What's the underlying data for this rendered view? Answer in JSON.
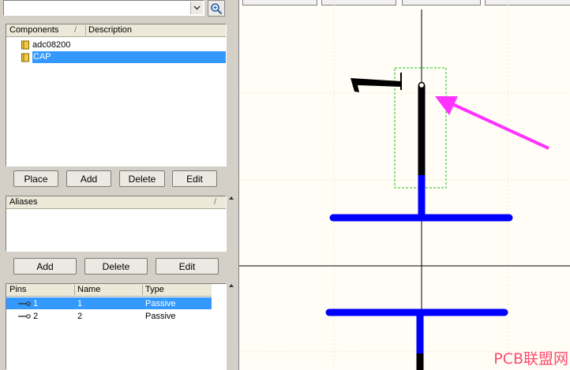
{
  "search": {
    "value": "",
    "dropdown_icon": "chevron-down-icon",
    "zoom_icon": "magnify-icon"
  },
  "components": {
    "headers": [
      "Components",
      "Description"
    ],
    "items": [
      {
        "name": "adc08200",
        "icon": "library-book-icon",
        "selected": false
      },
      {
        "name": "CAP",
        "icon": "library-book-icon",
        "selected": true
      }
    ]
  },
  "component_buttons": {
    "place": "Place",
    "add": "Add",
    "delete": "Delete",
    "edit": "Edit"
  },
  "aliases": {
    "header": "Aliases"
  },
  "alias_buttons": {
    "add": "Add",
    "delete": "Delete",
    "edit": "Edit"
  },
  "pins": {
    "headers": [
      "Pins",
      "Name",
      "Type"
    ],
    "rows": [
      {
        "pin": "1",
        "name": "1",
        "type": "Passive",
        "selected": true
      },
      {
        "pin": "2",
        "name": "2",
        "type": "Passive",
        "selected": false
      }
    ]
  },
  "watermark": "PCB联盟网",
  "colors": {
    "selection": "#3399ff",
    "wire": "#0000ff",
    "pin": "#000000",
    "arrow": "#ff33ff",
    "canvas": "#fffdf5"
  }
}
